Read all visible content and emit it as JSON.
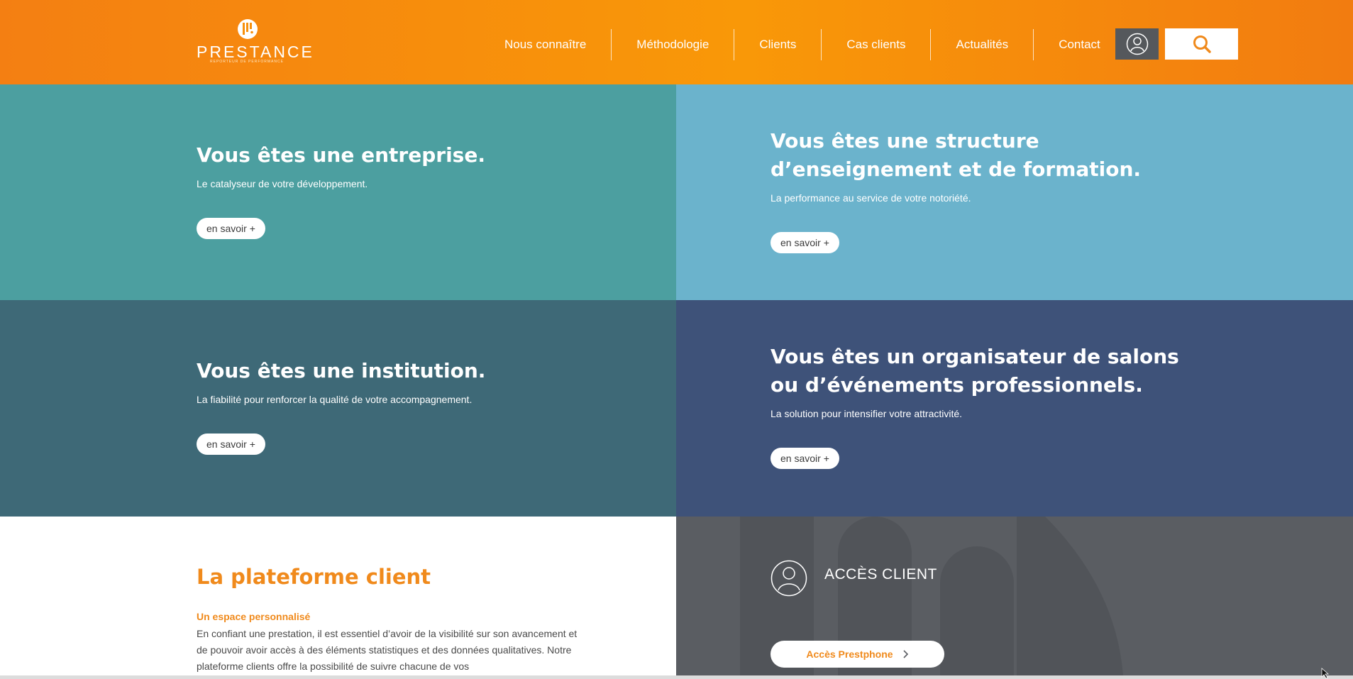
{
  "header": {
    "logo": {
      "name": "PRESTANCE",
      "tagline": "REPORTEUR DE PERFORMANCE"
    },
    "nav": [
      {
        "label": "Nous connaître"
      },
      {
        "label": "Méthodologie"
      },
      {
        "label": "Clients"
      },
      {
        "label": "Cas clients"
      },
      {
        "label": "Actualités"
      },
      {
        "label": "Contact"
      }
    ],
    "account_icon": "user-icon",
    "search_icon": "search-icon"
  },
  "tiles": [
    {
      "title": "Vous êtes une entreprise.",
      "subtitle": "Le catalyseur de votre développement.",
      "button": "en savoir +"
    },
    {
      "title": "Vous êtes une structure d’enseignement et de formation.",
      "subtitle": "La performance au service de votre notoriété.",
      "button": "en savoir +"
    },
    {
      "title": "Vous êtes une institution.",
      "subtitle": "La fiabilité pour renforcer la qualité de votre accompagnement.",
      "button": "en savoir +"
    },
    {
      "title": "Vous êtes un organisateur de salons ou d’événements professionnels.",
      "subtitle": "La solution pour intensifier votre attractivité.",
      "button": "en savoir +"
    }
  ],
  "platform": {
    "title": "La plateforme client",
    "subtitle": "Un espace personnalisé",
    "body": "En confiant une prestation, il est essentiel d’avoir de la visibilité sur son avancement et de pouvoir avoir accès à des éléments statistiques et des données qualitatives. Notre plateforme clients offre la possibilité de suivre chacune de vos"
  },
  "access": {
    "title": "ACCÈS CLIENT",
    "button": "Accès Prestphone"
  },
  "colors": {
    "header": "#f7900d",
    "tile1": "#4c9fa0",
    "tile2": "#6bb3cc",
    "tile3": "#3e6977",
    "tile4": "#3e5279",
    "accent": "#f08a1c",
    "access_bg": "#5a5d62"
  }
}
